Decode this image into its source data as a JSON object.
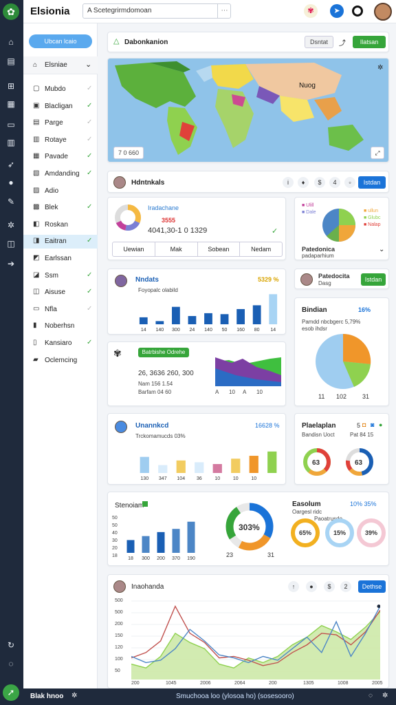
{
  "app": {
    "title": "Elsionia"
  },
  "search": {
    "value": "A Scetegrirmdomoan"
  },
  "sidebar": {
    "button": "Ubcan lcaio",
    "section": "Elsniae",
    "items": [
      {
        "label": "Mubdo",
        "check": "gray"
      },
      {
        "label": "Blacligan",
        "check": "green"
      },
      {
        "label": "Parge",
        "check": "gray"
      },
      {
        "label": "Rotaye",
        "check": "gray"
      },
      {
        "label": "Pavade",
        "check": "green"
      },
      {
        "label": "Amdanding",
        "check": "green"
      },
      {
        "label": "Adio",
        "check": ""
      },
      {
        "label": "Blek",
        "check": "green"
      },
      {
        "label": "Roskan",
        "check": ""
      },
      {
        "label": "Eaitran",
        "check": "green"
      },
      {
        "label": "Earlssan",
        "check": ""
      },
      {
        "label": "Ssm",
        "check": "green"
      },
      {
        "label": "Aisuse",
        "check": "green"
      },
      {
        "label": "Nfla",
        "check": "gray"
      },
      {
        "label": "Noberhsn",
        "check": ""
      },
      {
        "label": "Kansiaro",
        "check": "green"
      },
      {
        "label": "Oclemcing",
        "check": ""
      }
    ]
  },
  "map_card": {
    "title": "Dabonkanion",
    "btn1": "Dsntat",
    "btn2": "Ilatsan",
    "zoom": "7 0 660",
    "map_label": "Nuog"
  },
  "overview": {
    "title": "Hdntnkals",
    "btn": "Istdan",
    "donut_title": "Iradachane",
    "value_red": "3555",
    "value_main": "4041,30-1 0  1329",
    "tabs": [
      "Uewian",
      "Mak",
      "Sobean",
      "Nedam"
    ],
    "pie_legend": [
      "Ulill",
      "Dale",
      "ullun",
      "Glubc",
      "Nalap"
    ],
    "pie_caption": "Patedonica",
    "pie_sub": "padaparhium"
  },
  "bars1": {
    "title": "Nndats",
    "pct": "5329 %",
    "sub": "Foyopalc olabild",
    "labels": [
      "14",
      "140",
      "300",
      "24",
      "140",
      "50",
      "160",
      "80",
      "14"
    ],
    "values": [
      22,
      10,
      55,
      26,
      35,
      32,
      48,
      60,
      95
    ],
    "ylim": [
      0,
      100
    ]
  },
  "profile": {
    "title": "Patedocita",
    "sub": "Dasg",
    "btn": "Istdan"
  },
  "pie_card": {
    "title": "Bindian",
    "pct": "16%",
    "sub": "Pamdd nbcbgerc 5,79%",
    "sub2": "esob ihdsr",
    "labels": [
      "11",
      "102",
      "31"
    ],
    "values": [
      30,
      25,
      45
    ]
  },
  "stats": {
    "badge": "Batrbishe Odrehe",
    "line1": "26, 3636  260, 300",
    "line2": "Nam 156 1.54",
    "line3": "Barfam 04 60",
    "axis": [
      "A",
      "10",
      "A",
      "10"
    ]
  },
  "bars2": {
    "title": "Unannkcd",
    "pct": "16628 %",
    "sub": "Trckomamucds 03%",
    "labels": [
      "130",
      "347",
      "104",
      "36",
      "10",
      "10",
      "10"
    ],
    "values": [
      45,
      22,
      35,
      30,
      25,
      40,
      48,
      60
    ],
    "ylim": [
      0,
      100
    ]
  },
  "gauges": {
    "title": "Plaelaplan",
    "pct": "5",
    "sub1": "Bandisn Uoct",
    "sub2": "Pat 84 15",
    "g1": "63",
    "g2": "63"
  },
  "bars3": {
    "title": "Stenoiam",
    "ticks": [
      "50",
      "50",
      "40",
      "30",
      "20",
      "18"
    ],
    "labels": [
      "18",
      "300",
      "200",
      "370",
      "190"
    ],
    "values": [
      32,
      42,
      52,
      60,
      78
    ],
    "ylim": [
      0,
      100
    ]
  },
  "donut": {
    "value": "303%",
    "left": "23",
    "right": "31"
  },
  "rings": {
    "title": "Easolum",
    "pct": "10%  35%",
    "sub": "Oargesl ridc",
    "sub2": "Paoatrusdo",
    "r1": "65%",
    "r2": "15%",
    "r3": "39%"
  },
  "trends": {
    "title": "Inaohanda",
    "btn": "Dethse",
    "yticks": [
      "500",
      "500",
      "200",
      "150",
      "120",
      "100",
      "50"
    ],
    "xticks": [
      "200",
      "1045",
      "2006",
      "2064",
      "200",
      "1305",
      "1008",
      "2005"
    ],
    "series": [
      {
        "name": "area",
        "color": "#8fd14f",
        "values": [
          20,
          15,
          30,
          60,
          48,
          40,
          20,
          15,
          28,
          22,
          30,
          45,
          55,
          70,
          62,
          52,
          68,
          88
        ]
      },
      {
        "name": "red",
        "color": "#c0504d",
        "values": [
          28,
          35,
          50,
          95,
          60,
          48,
          28,
          30,
          25,
          18,
          22,
          35,
          45,
          60,
          58,
          45,
          62,
          90
        ]
      },
      {
        "name": "blue",
        "color": "#4c86c6",
        "values": [
          30,
          22,
          25,
          40,
          65,
          50,
          32,
          28,
          22,
          30,
          25,
          40,
          55,
          35,
          75,
          30,
          60,
          95
        ]
      }
    ]
  },
  "footer": {
    "left": "Blak hnoo",
    "center": "Smuchooa loo (ylosoa ho) (sosesooro)"
  },
  "colors": {
    "accent": "#1a73d8",
    "green": "#36a53a",
    "rail": "#1f2a3c"
  }
}
